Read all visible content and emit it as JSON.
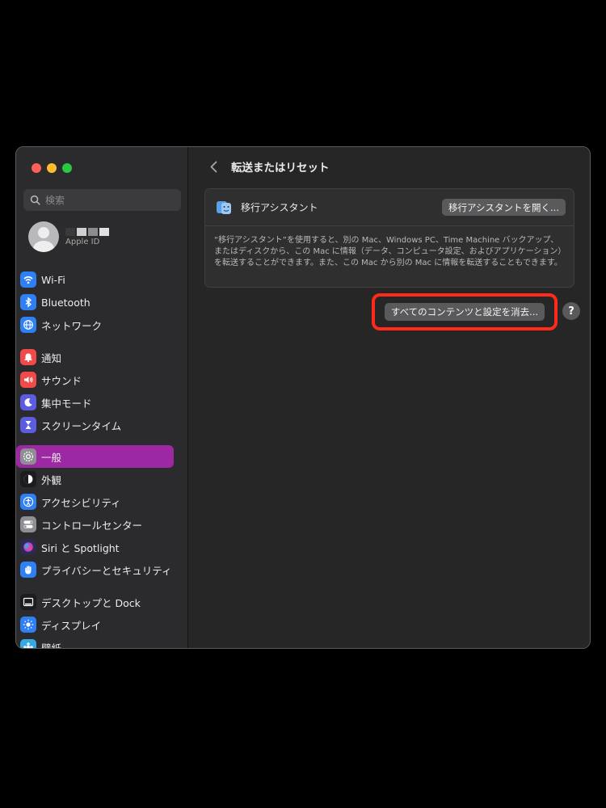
{
  "sidebar": {
    "search_placeholder": "検索",
    "account": {
      "subtitle": "Apple ID"
    },
    "groups": [
      [
        {
          "label": "Wi-Fi",
          "icon": "wifi-icon",
          "color": "#2f7ff5"
        },
        {
          "label": "Bluetooth",
          "icon": "bluetooth-icon",
          "color": "#2f7ff5"
        },
        {
          "label": "ネットワーク",
          "icon": "globe-icon",
          "color": "#2f7ff5"
        }
      ],
      [
        {
          "label": "通知",
          "icon": "bell-icon",
          "color": "#f04a4a"
        },
        {
          "label": "サウンド",
          "icon": "speaker-icon",
          "color": "#f04a4a"
        },
        {
          "label": "集中モード",
          "icon": "moon-icon",
          "color": "#5c5ce0"
        },
        {
          "label": "スクリーンタイム",
          "icon": "hourglass-icon",
          "color": "#5c5ce0"
        }
      ],
      [
        {
          "label": "一般",
          "icon": "gear-icon",
          "color": "#8e8e93",
          "active": true
        },
        {
          "label": "外観",
          "icon": "appearance-icon",
          "color": "#1c1c1e"
        },
        {
          "label": "アクセシビリティ",
          "icon": "accessibility-icon",
          "color": "#2f7ff5"
        },
        {
          "label": "コントロールセンター",
          "icon": "toggles-icon",
          "color": "#8e8e93"
        },
        {
          "label": "Siri と Spotlight",
          "icon": "siri-icon",
          "color": "#2b2b4d"
        },
        {
          "label": "プライバシーとセキュリティ",
          "icon": "hand-icon",
          "color": "#2f7ff5"
        }
      ],
      [
        {
          "label": "デスクトップと Dock",
          "icon": "dock-icon",
          "color": "#1c1c1e"
        },
        {
          "label": "ディスプレイ",
          "icon": "sun-icon",
          "color": "#2f7ff5"
        },
        {
          "label": "壁紙",
          "icon": "wallpaper-icon",
          "color": "#36a9e0"
        }
      ]
    ]
  },
  "main": {
    "title": "転送またはリセット",
    "migration": {
      "label": "移行アシスタント",
      "button": "移行アシスタントを開く...",
      "description": "“移行アシスタント”を使用すると、別の Mac、Windows PC、Time Machine バックアップ、またはディスクから、この Mac に情報（データ、コンピュータ設定、およびアプリケーション）を転送することができます。また、この Mac から別の Mac に情報を転送することもできます。"
    },
    "erase_button": "すべてのコンテンツと設定を消去...",
    "help": "?"
  }
}
